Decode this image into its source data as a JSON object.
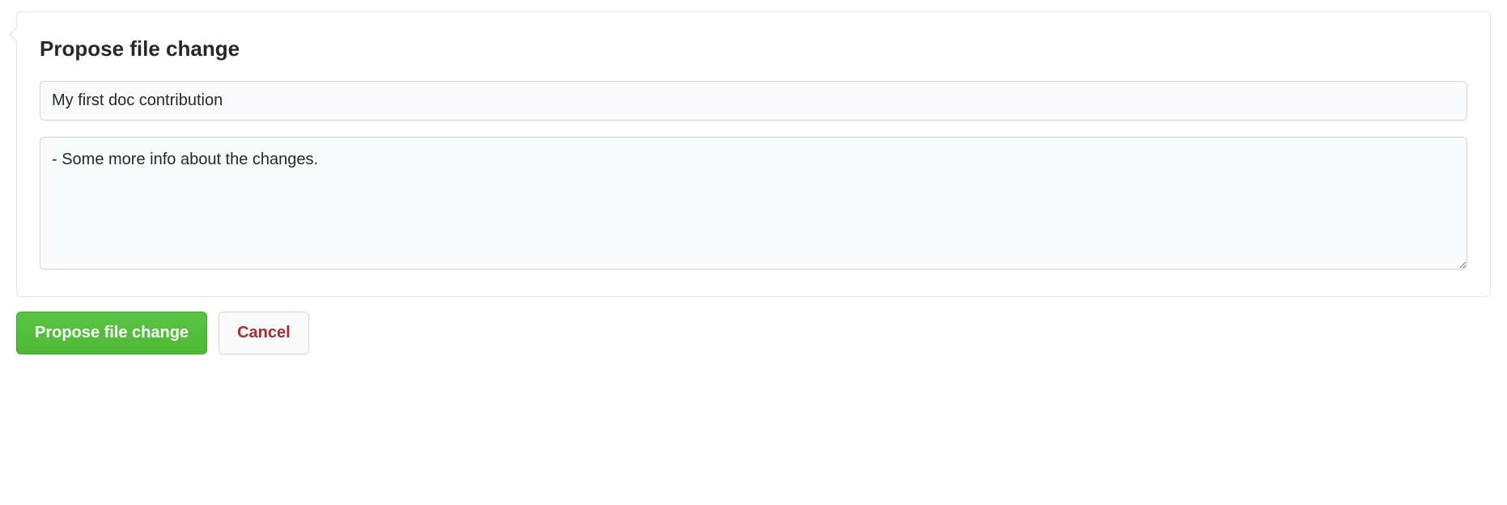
{
  "panel": {
    "title": "Propose file change"
  },
  "form": {
    "summary_value": "My first doc contribution",
    "description_value": "- Some more info about the changes."
  },
  "actions": {
    "propose_label": "Propose file change",
    "cancel_label": "Cancel"
  }
}
